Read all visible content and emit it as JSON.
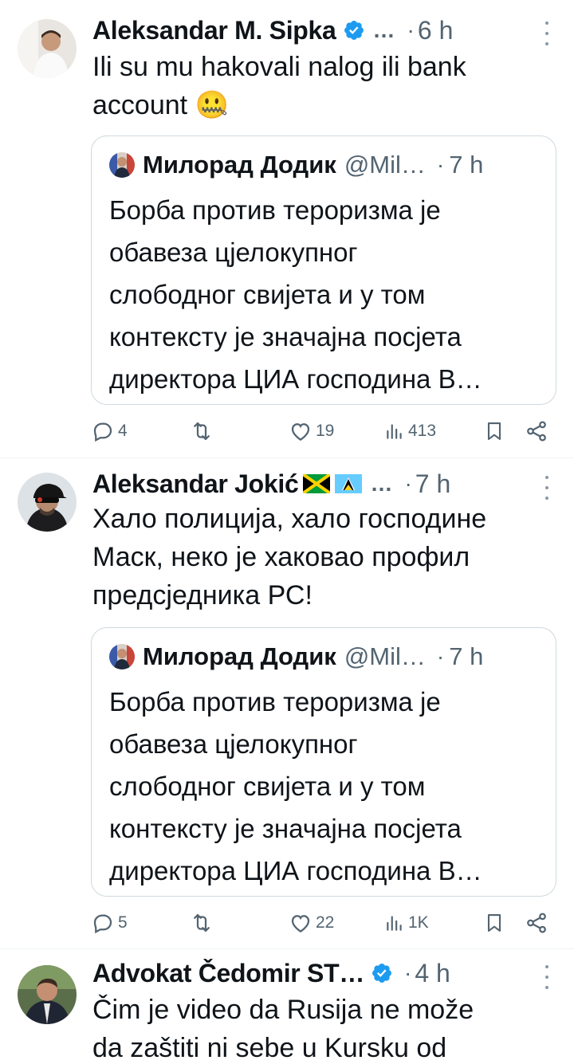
{
  "tweets": [
    {
      "author": "Aleksandar M. Sipka",
      "truncated": "…",
      "time": "6 h",
      "text_lines": [
        "Ili su mu hakovali nalog ili bank",
        "account 🤐"
      ],
      "quote": {
        "author": "Милорад Додик",
        "handle": "@Mil…",
        "time": "7 h",
        "text_lines": [
          "Борба против тероризма је",
          "обавеза цјелокупног",
          "слободног свијета и у том",
          "контексту је значајна посјета",
          "директора ЦИА господина В…"
        ]
      },
      "stats": {
        "replies": "4",
        "retweets": "",
        "likes": "19",
        "views": "413"
      }
    },
    {
      "author": "Aleksandar Jokić",
      "flags": [
        "jamaica-flag-icon",
        "saint-lucia-flag-icon"
      ],
      "truncated": "…",
      "time": "7 h",
      "text_lines": [
        "Хало полиција, хало господине",
        "Маск, неко је хаковао профил",
        "предсједника РС!"
      ],
      "quote": {
        "author": "Милорад Додик",
        "handle": "@Mil…",
        "time": "7 h",
        "text_lines": [
          "Борба против тероризма је",
          "обавеза цјелокупног",
          "слободног свијета и у том",
          "контексту је значајна посјета",
          "директора ЦИА господина В…"
        ]
      },
      "stats": {
        "replies": "5",
        "retweets": "",
        "likes": "22",
        "views": "1K"
      }
    },
    {
      "author": "Advokat Čedomir ST…",
      "time": "4 h",
      "text_lines": [
        "Čim je video da Rusija ne može",
        "da zaštiti ni sebe u Kursku od"
      ]
    }
  ],
  "colors": {
    "verified": "#1d9bf0",
    "muted": "#536471",
    "border": "#cfd9de",
    "text": "#0f1419"
  },
  "icons": [
    "reply-icon",
    "retweet-icon",
    "like-icon",
    "views-icon",
    "bookmark-icon",
    "share-icon",
    "verified-badge-icon",
    "more-icon"
  ]
}
